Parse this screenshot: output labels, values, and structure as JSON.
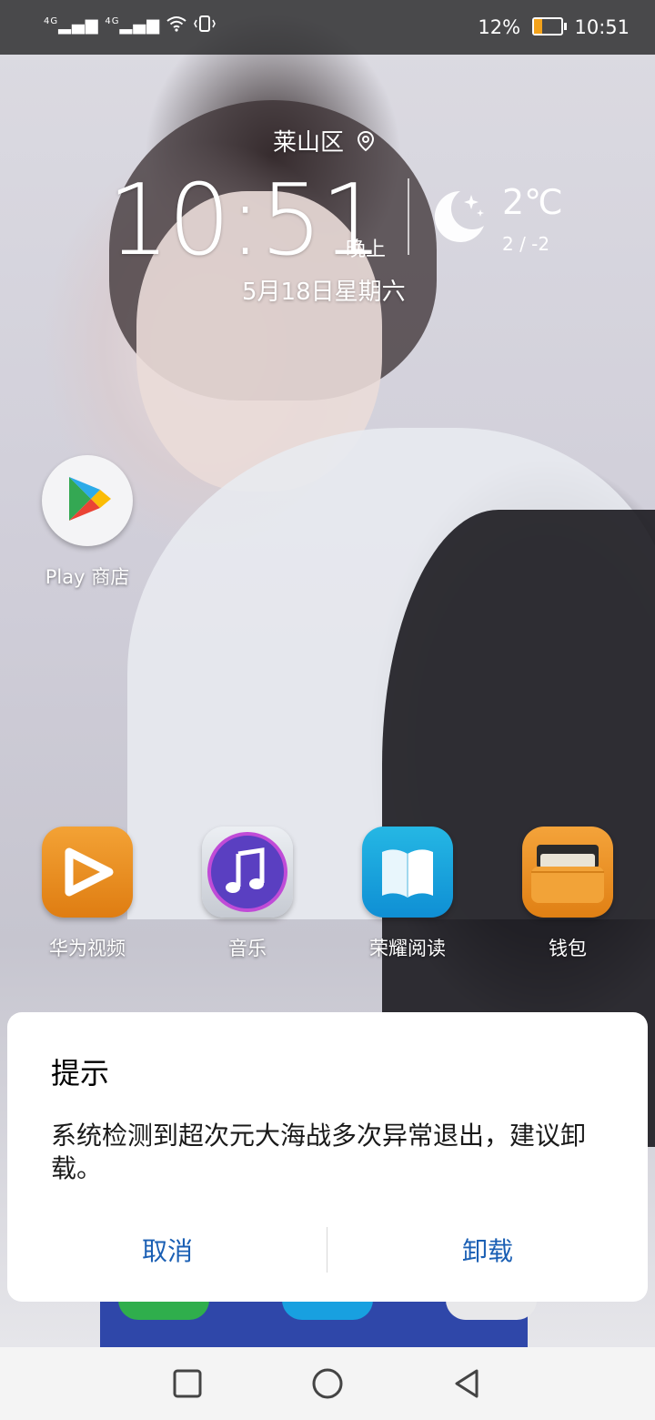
{
  "status_bar": {
    "signal_label_1": "4G",
    "signal_label_2": "4G",
    "battery_percent": "12%",
    "battery_level": 0.12,
    "time": "10:51",
    "icons": [
      "signal-4g-icon",
      "signal-4g-icon",
      "wifi-icon",
      "vibrate-icon",
      "battery-icon"
    ]
  },
  "clock_widget": {
    "location": "莱山区",
    "time": "10:51",
    "period": "晚上",
    "temperature": "2℃",
    "temp_range": "2 / -2",
    "date": "5月18日星期六",
    "weather_icon": "moon-icon"
  },
  "apps": {
    "play_store": "Play 商店",
    "huawei_video": "华为视频",
    "music": "音乐",
    "honor_reading": "荣耀阅读",
    "wallet": "钱包"
  },
  "dialog": {
    "title": "提示",
    "message": "系统检测到超次元大海战多次异常退出，建议卸载。",
    "cancel_label": "取消",
    "uninstall_label": "卸载"
  },
  "colors": {
    "dialog_button": "#1a5fb4",
    "battery_low": "#f3a21b"
  },
  "nav_bar": {
    "icons": [
      "square-icon",
      "circle-icon",
      "triangle-back-icon"
    ]
  }
}
